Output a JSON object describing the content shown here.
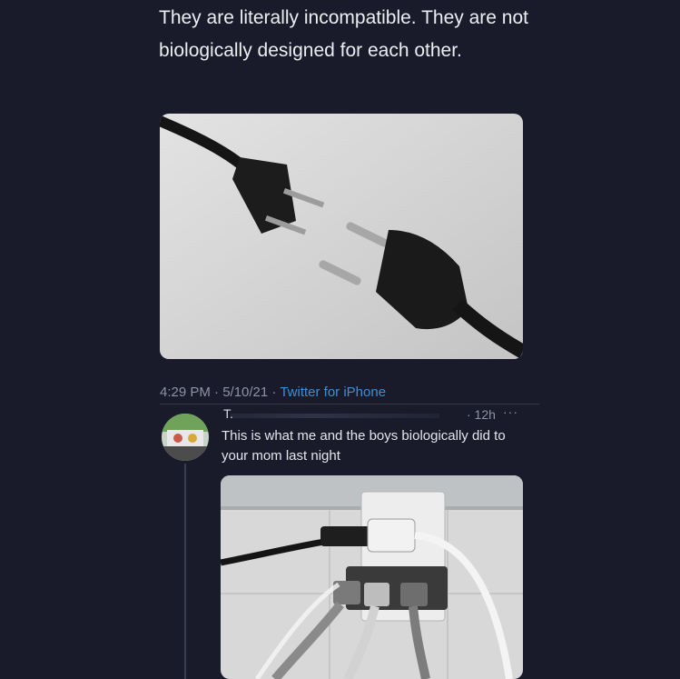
{
  "tweet": {
    "text": "They are literally incompatible. They are not biologically designed for each other.",
    "timestamp": "4:29 PM · 5/10/21 · ",
    "source": "Twitter for iPhone",
    "image_description_icon": "plug-photo-icon"
  },
  "reply": {
    "author": "T.",
    "time": "· 12h",
    "more": "···",
    "text": "This is what me and the boys biologically did to your mom last night",
    "image_icon": "socket-photo-icon",
    "avatar_icon": "avatar-icon"
  },
  "colors": {
    "background": "#191b2a",
    "text": "#eceef2",
    "muted": "#8b93a6",
    "link": "#3d8fd8"
  }
}
